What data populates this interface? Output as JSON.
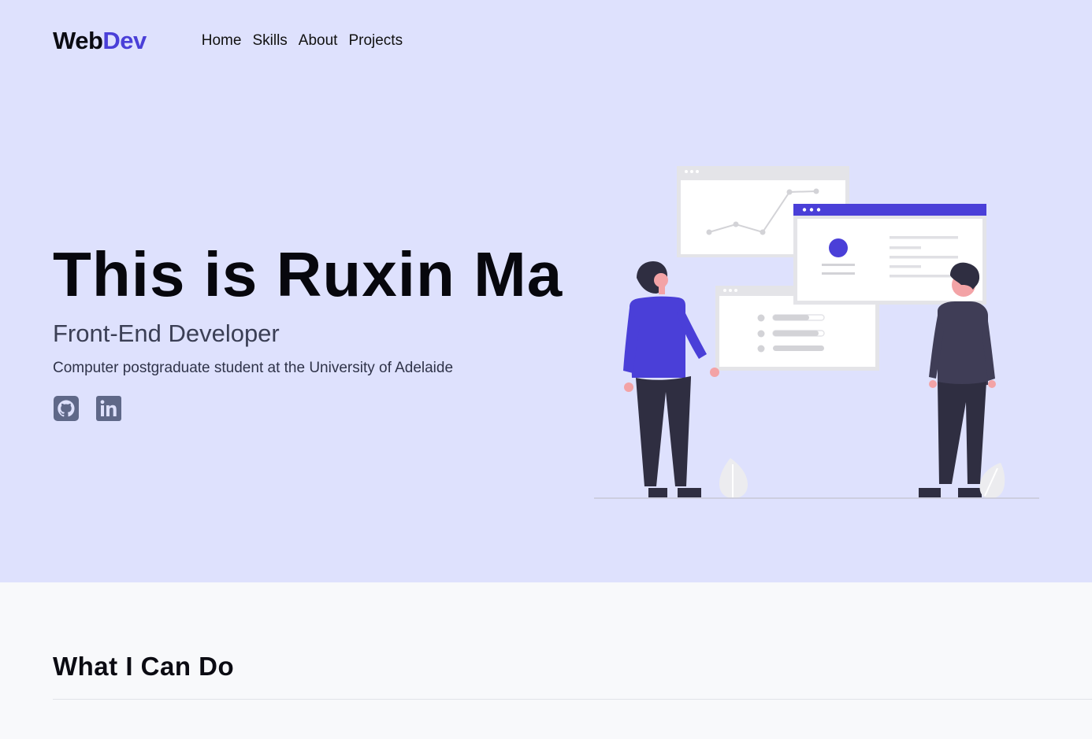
{
  "brand": {
    "logo_part1": "Web",
    "logo_part2": "Dev",
    "accent_color": "#4a3fd8"
  },
  "nav": {
    "items": [
      {
        "label": "Home"
      },
      {
        "label": "Skills"
      },
      {
        "label": "About"
      },
      {
        "label": "Projects"
      }
    ]
  },
  "hero": {
    "title": "This is Ruxin Ma",
    "subtitle": "Front-End Developer",
    "description": "Computer postgraduate student at the University of Adelaide",
    "background_color": "#dee1fd",
    "social": [
      {
        "icon": "github-icon"
      },
      {
        "icon": "linkedin-icon"
      }
    ]
  },
  "section": {
    "title": "What I Can Do",
    "background_color": "#f8f9fb"
  }
}
